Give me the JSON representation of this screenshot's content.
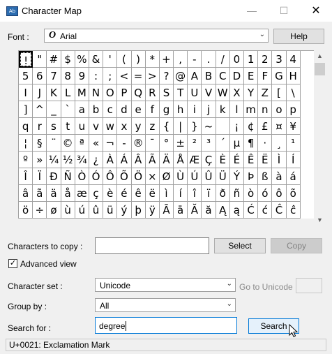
{
  "window": {
    "title": "Character Map",
    "minimize": "—",
    "maximize": "☐",
    "close": "✕"
  },
  "font": {
    "label": "Font :",
    "value": "Arial",
    "icon_glyph": "O",
    "help_button": "Help"
  },
  "grid": {
    "rows": [
      [
        "!",
        "\"",
        "#",
        "$",
        "%",
        "&",
        "'",
        "(",
        ")",
        "*",
        "+",
        ",",
        "-",
        ".",
        "/",
        "0",
        "1",
        "2",
        "3",
        "4"
      ],
      [
        "5",
        "6",
        "7",
        "8",
        "9",
        ":",
        ";",
        "<",
        "=",
        ">",
        "?",
        "@",
        "A",
        "B",
        "C",
        "D",
        "E",
        "F",
        "G",
        "H"
      ],
      [
        "I",
        "J",
        "K",
        "L",
        "M",
        "N",
        "O",
        "P",
        "Q",
        "R",
        "S",
        "T",
        "U",
        "V",
        "W",
        "X",
        "Y",
        "Z",
        "[",
        "\\"
      ],
      [
        "]",
        "^",
        "_",
        "`",
        "a",
        "b",
        "c",
        "d",
        "e",
        "f",
        "g",
        "h",
        "i",
        "j",
        "k",
        "l",
        "m",
        "n",
        "o",
        "p"
      ],
      [
        "q",
        "r",
        "s",
        "t",
        "u",
        "v",
        "w",
        "x",
        "y",
        "z",
        "{",
        "|",
        "}",
        "~",
        " ",
        "¡",
        "¢",
        "£",
        "¤",
        "¥"
      ],
      [
        "¦",
        "§",
        "¨",
        "©",
        "ª",
        "«",
        "¬",
        "-",
        "®",
        "¯",
        "°",
        "±",
        "²",
        "³",
        "´",
        "µ",
        "¶",
        "·",
        "¸",
        "¹"
      ],
      [
        "º",
        "»",
        "¼",
        "½",
        "¾",
        "¿",
        "À",
        "Á",
        "Â",
        "Ã",
        "Ä",
        "Å",
        "Æ",
        "Ç",
        "È",
        "É",
        "Ê",
        "Ë",
        "Ì",
        "Í"
      ],
      [
        "Î",
        "Ï",
        "Ð",
        "Ñ",
        "Ò",
        "Ó",
        "Ô",
        "Õ",
        "Ö",
        "×",
        "Ø",
        "Ù",
        "Ú",
        "Û",
        "Ü",
        "Ý",
        "Þ",
        "ß",
        "à",
        "á"
      ],
      [
        "â",
        "ã",
        "ä",
        "å",
        "æ",
        "ç",
        "è",
        "é",
        "ê",
        "ë",
        "ì",
        "í",
        "î",
        "ï",
        "ð",
        "ñ",
        "ò",
        "ó",
        "ô",
        "õ"
      ],
      [
        "ö",
        "÷",
        "ø",
        "ù",
        "ú",
        "û",
        "ü",
        "ý",
        "þ",
        "ÿ",
        "Ā",
        "ā",
        "Ă",
        "ă",
        "Ą",
        "ą",
        "Ć",
        "ć",
        "Ĉ",
        "ĉ"
      ]
    ],
    "selected": "!"
  },
  "copy": {
    "label": "Characters to copy :",
    "value": "",
    "select_button": "Select",
    "copy_button": "Copy"
  },
  "advanced": {
    "label": "Advanced view",
    "checked": true
  },
  "charset": {
    "label": "Character set :",
    "value": "Unicode",
    "goto_label": "Go to Unicode :",
    "goto_value": ""
  },
  "groupby": {
    "label": "Group by :",
    "value": "All"
  },
  "search": {
    "label": "Search for :",
    "value": "degree",
    "button": "Search"
  },
  "status": {
    "text": "U+0021: Exclamation Mark"
  }
}
